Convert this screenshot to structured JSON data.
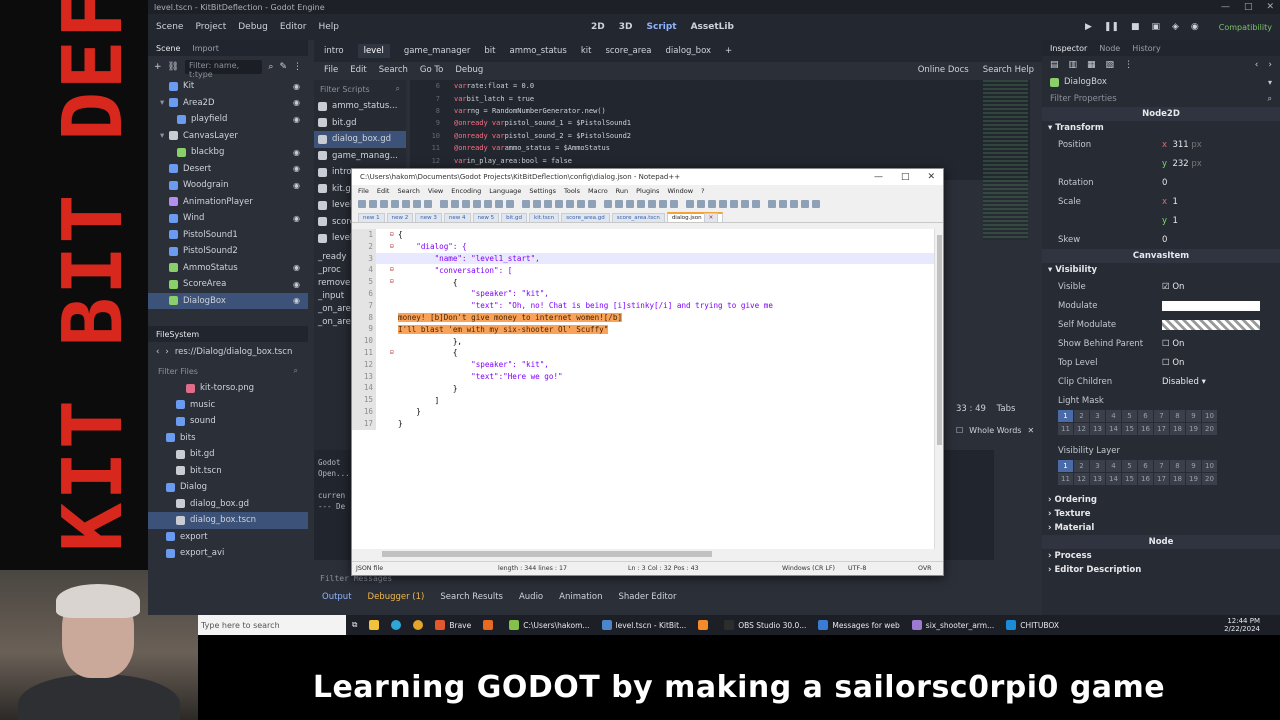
{
  "overlay": {
    "side_title": "KIT BIT DEFLECTION",
    "bottom_title": "Learning GODOT by making a sailorsc0rpi0 game"
  },
  "godot": {
    "window_title": "level.tscn - KitBitDeflection - Godot Engine",
    "menu": [
      "Scene",
      "Project",
      "Debug",
      "Editor",
      "Help"
    ],
    "workspaces": [
      "2D",
      "3D",
      "Script",
      "AssetLib"
    ],
    "active_workspace": "Script",
    "renderer": "Compatibility",
    "scene_dock": {
      "tabs": [
        "Scene",
        "Import"
      ],
      "filter_placeholder": "Filter: name, t:type",
      "nodes": [
        {
          "label": "Kit",
          "icon": "ib",
          "eye": "eye-icon"
        },
        {
          "label": "Area2D",
          "icon": "ib",
          "eye": "eye-icon"
        },
        {
          "label": "playfield",
          "icon": "ib",
          "eye": "eye-icon"
        },
        {
          "label": "CanvasLayer",
          "icon": "iw",
          "eye": ""
        },
        {
          "label": "blackbg",
          "icon": "ig",
          "eye": "eye-icon"
        },
        {
          "label": "Desert",
          "icon": "ib",
          "eye": "eye-icon"
        },
        {
          "label": "Woodgrain",
          "icon": "ib",
          "eye": "eye-icon"
        },
        {
          "label": "AnimationPlayer",
          "icon": "iv",
          "eye": ""
        },
        {
          "label": "Wind",
          "icon": "ib",
          "eye": "eye-icon"
        },
        {
          "label": "PistolSound1",
          "icon": "ib",
          "eye": ""
        },
        {
          "label": "PistolSound2",
          "icon": "ib",
          "eye": ""
        },
        {
          "label": "AmmoStatus",
          "icon": "ig",
          "eye": "eye-icon"
        },
        {
          "label": "ScoreArea",
          "icon": "ig",
          "eye": "eye-icon"
        },
        {
          "label": "DialogBox",
          "icon": "ig",
          "eye": "eye-icon"
        }
      ]
    },
    "filesystem_dock": {
      "title": "FileSystem",
      "path": "res://Dialog/dialog_box.tscn",
      "filter_placeholder": "Filter Files",
      "items": [
        {
          "label": "kit-torso.png",
          "indent": 3,
          "icon": "ip"
        },
        {
          "label": "music",
          "indent": 2,
          "icon": "ib"
        },
        {
          "label": "sound",
          "indent": 2,
          "icon": "ib"
        },
        {
          "label": "bits",
          "indent": 1,
          "icon": "ib"
        },
        {
          "label": "bit.gd",
          "indent": 2,
          "icon": "iw"
        },
        {
          "label": "bit.tscn",
          "indent": 2,
          "icon": "iw"
        },
        {
          "label": "Dialog",
          "indent": 1,
          "icon": "ib"
        },
        {
          "label": "dialog_box.gd",
          "indent": 2,
          "icon": "iw"
        },
        {
          "label": "dialog_box.tscn",
          "indent": 2,
          "icon": "iw"
        },
        {
          "label": "export",
          "indent": 1,
          "icon": "ib"
        },
        {
          "label": "export_avi",
          "indent": 1,
          "icon": "ib"
        }
      ]
    },
    "editor_tabs": [
      "intro",
      "level",
      "game_manager",
      "bit",
      "ammo_status",
      "kit",
      "score_area",
      "dialog_box"
    ],
    "active_editor_tab": "level",
    "script_menu": [
      "File",
      "Edit",
      "Search",
      "Go To",
      "Debug"
    ],
    "script_menu_right": [
      "Online Docs",
      "Search Help"
    ],
    "script_list": {
      "filter_placeholder": "Filter Scripts",
      "items": [
        "ammo_status...",
        "bit.gd",
        "dialog_box.gd",
        "game_manag...",
        "intro",
        "kit.gd",
        "level",
        "score_area",
        "level.gd"
      ]
    },
    "code_lines": [
      {
        "n": "6",
        "kw": "var",
        "rest": " rate:float = 0.0"
      },
      {
        "n": "7",
        "kw": "var",
        "rest": " bit_latch = true"
      },
      {
        "n": "8",
        "kw": "var",
        "rest": " rng = RandomNumberGenerator.new()"
      },
      {
        "n": "9",
        "kw": "@onready var",
        "rest": " pistol_sound_1 = $PistolSound1"
      },
      {
        "n": "10",
        "kw": "@onready var",
        "rest": " pistol_sound_2 = $PistolSound2"
      },
      {
        "n": "11",
        "kw": "@onready var",
        "rest": " ammo_status = $AmmoStatus"
      },
      {
        "n": "12",
        "kw": "var",
        "rest": " in_play_area:bool = false"
      }
    ],
    "code_status": "33 :  49",
    "code_status_tabs": "Tabs",
    "find_option": "Whole Words",
    "bottom_tabs": [
      "Output",
      "Debugger (1)",
      "Search Results",
      "Audio",
      "Animation",
      "Shader Editor"
    ],
    "version": "4.2.stable",
    "output_lines": [
      "Godot",
      "Open...",
      "",
      "curren",
      "--- De"
    ],
    "func_list": [
      "_ready",
      "_proc",
      "remove",
      "_input",
      "_on_are",
      "_on_are"
    ],
    "filter_messages": "Filter Messages"
  },
  "inspector": {
    "tabs": [
      "Inspector",
      "Node",
      "History"
    ],
    "node_name": "DialogBox",
    "filter_placeholder": "Filter Properties",
    "class_node2d": "Node2D",
    "transform_header": "Transform",
    "position_label": "Position",
    "position_x": "311",
    "position_y": "232",
    "unit": "px",
    "rotation_label": "Rotation",
    "rotation_value": "0",
    "scale_label": "Scale",
    "scale_x": "1",
    "scale_y": "1",
    "skew_label": "Skew",
    "skew_value": "0",
    "class_canvasitem": "CanvasItem",
    "visibility_header": "Visibility",
    "visible_label": "Visible",
    "on_label": "On",
    "modulate_label": "Modulate",
    "self_modulate_label": "Self Modulate",
    "show_behind_label": "Show Behind Parent",
    "top_level_label": "Top Level",
    "clip_children_label": "Clip Children",
    "clip_children_value": "Disabled",
    "light_mask_label": "Light Mask",
    "visibility_layer_label": "Visibility Layer",
    "layer_numbers": [
      "1",
      "2",
      "3",
      "4",
      "5",
      "6",
      "7",
      "8",
      "9",
      "10",
      "11",
      "12",
      "13",
      "14",
      "15",
      "16",
      "17",
      "18",
      "19",
      "20"
    ],
    "ordering_header": "Ordering",
    "texture_header": "Texture",
    "material_header": "Material",
    "class_node": "Node",
    "process_header": "Process",
    "editor_desc_header": "Editor Description"
  },
  "notepad": {
    "title": "C:\\Users\\hakom\\Documents\\Godot Projects\\KitBitDeflection\\config\\dialog.json - Notepad++",
    "menu": [
      "File",
      "Edit",
      "Search",
      "View",
      "Encoding",
      "Language",
      "Settings",
      "Tools",
      "Macro",
      "Run",
      "Plugins",
      "Window",
      "?"
    ],
    "tabs": [
      "new 1",
      "new 2",
      "new 3",
      "new 4",
      "new 5",
      "bit.gd",
      "kit.tscn",
      "score_area.gd",
      "score_area.tscn",
      "dialog.json"
    ],
    "active_tab": "dialog.json",
    "lines": [
      {
        "n": "1",
        "fold": "⊟",
        "text": "{"
      },
      {
        "n": "2",
        "fold": "⊟",
        "text": "    \"dialog\": {"
      },
      {
        "n": "3",
        "fold": "",
        "text": "        \"name\": \"level1_start\","
      },
      {
        "n": "4",
        "fold": "⊟",
        "text": "        \"conversation\": ["
      },
      {
        "n": "5",
        "fold": "⊟",
        "text": "            {"
      },
      {
        "n": "6",
        "fold": "",
        "text": "                \"speaker\": \"kit\","
      },
      {
        "n": "7",
        "fold": "",
        "text": "                \"text\": \"Oh, no! Chat is being [i]stinky[/i] and trying to give me"
      },
      {
        "n": "8",
        "fold": "",
        "text": "money! [b]Don't give money to internet women![/b]"
      },
      {
        "n": "9",
        "fold": "",
        "text": "I'll blast 'em with my six-shooter Ol' Scuffy\""
      },
      {
        "n": "10",
        "fold": "",
        "text": "            },"
      },
      {
        "n": "11",
        "fold": "⊟",
        "text": "            {"
      },
      {
        "n": "12",
        "fold": "",
        "text": "                \"speaker\": \"kit\","
      },
      {
        "n": "13",
        "fold": "",
        "text": "                \"text\":\"Here we go!\""
      },
      {
        "n": "14",
        "fold": "",
        "text": "            }"
      },
      {
        "n": "15",
        "fold": "",
        "text": "        ]"
      },
      {
        "n": "16",
        "fold": "",
        "text": "    }"
      },
      {
        "n": "17",
        "fold": "",
        "text": "}"
      }
    ],
    "status": {
      "type": "JSON file",
      "length": "length : 344    lines : 17",
      "pos": "Ln : 3    Col : 32    Pos : 43",
      "eol": "Windows (CR LF)",
      "enc": "UTF-8",
      "ovr": "OVR"
    }
  },
  "taskbar": {
    "search_placeholder": "Type here to search",
    "apps": [
      {
        "label": "Brave",
        "color": "#e2572b"
      },
      {
        "label": "",
        "color": "#e66a1f"
      },
      {
        "label": "C:\\Users\\hakom...",
        "color": "#84c14a"
      },
      {
        "label": "level.tscn - KitBit...",
        "color": "#4a86c8"
      },
      {
        "label": "",
        "color": "#f58a2a"
      },
      {
        "label": "OBS Studio 30.0...",
        "color": "#2d2d2d"
      },
      {
        "label": "Messages for web",
        "color": "#3a7bd5"
      },
      {
        "label": "six_shooter_arm...",
        "color": "#9c7ad2"
      },
      {
        "label": "CHITUBOX",
        "color": "#1a8cd8"
      }
    ],
    "time": "12:44 PM",
    "date": "2/22/2024"
  }
}
